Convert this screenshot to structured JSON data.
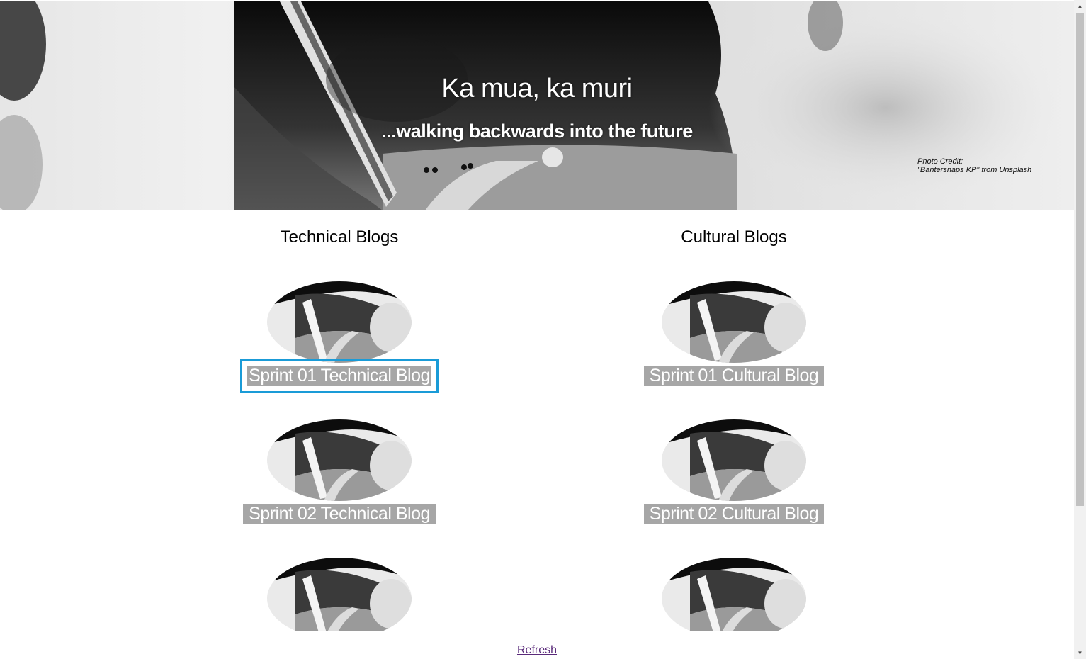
{
  "hero": {
    "title": "Ka mua, ka muri",
    "subtitle": "...walking backwards into the future",
    "credit_line1": "Photo Credit:",
    "credit_line2": "\"Bantersnaps KP\" from Unsplash"
  },
  "technical": {
    "heading": "Technical Blogs",
    "items": [
      {
        "label": "Sprint 01 Technical Blog"
      },
      {
        "label": "Sprint 02 Technical Blog"
      },
      {
        "label": ""
      }
    ]
  },
  "cultural": {
    "heading": "Cultural Blogs",
    "items": [
      {
        "label": "Sprint 01 Cultural Blog"
      },
      {
        "label": "Sprint 02 Cultural Blog"
      },
      {
        "label": ""
      }
    ]
  },
  "footer": {
    "refresh_label": "Refresh"
  },
  "colors": {
    "label_bg": "#a6a6a6",
    "focus_ring": "#1a9bd7",
    "link_visited": "#5a2a7a"
  }
}
